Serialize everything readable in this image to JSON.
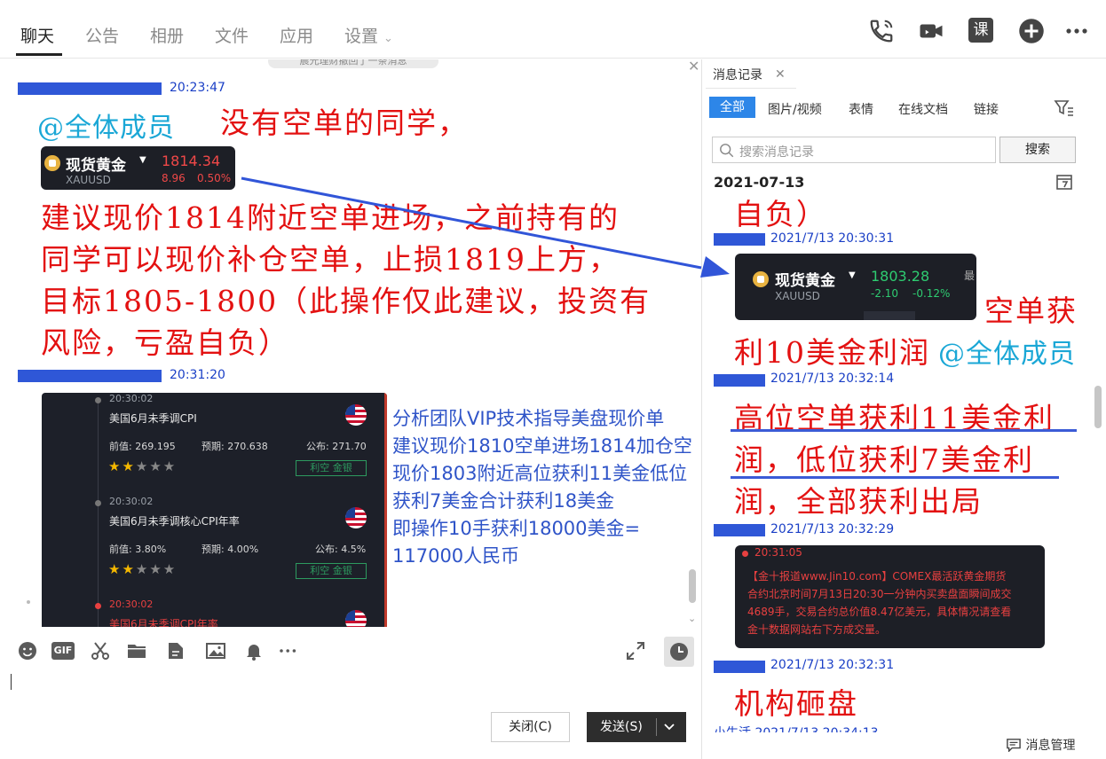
{
  "tabs": {
    "chat": "聊天",
    "notice": "公告",
    "album": "相册",
    "files": "文件",
    "apps": "应用",
    "settings": "设置"
  },
  "header_icons": [
    "phone-icon",
    "video-call-icon",
    "lesson-icon",
    "add-circle-icon",
    "more-icon"
  ],
  "header_lesson_label": "课",
  "chat": {
    "notice_pill": "晨光理财撤回了一条消息",
    "messages": [
      {
        "time": "20:23:47",
        "mention": "@全体成员",
        "headline": "没有空单的同学，",
        "ticker": {
          "name": "现货黄金",
          "symbol": "XAUUSD",
          "price": "1814.34",
          "change": "8.96",
          "change_pct": "0.50%"
        },
        "body_lines": [
          "建议现价1814附近空单进场，之前持有的",
          "同学可以现价补仓空单，止损1819上方，",
          "目标1805-1800（此操作仅此建议，投资有",
          "风险，亏盈自负）"
        ]
      },
      {
        "time": "20:31:20",
        "calendar": [
          {
            "time": "20:30:02",
            "title": "美国6月未季调CPI",
            "prev": "前值: 269.195",
            "forecast": "预期: 270.638",
            "actual": "公布: 271.70",
            "stars": 2,
            "badge": "利空  金银"
          },
          {
            "time": "20:30:02",
            "title": "美国6月未季调核心CPI年率",
            "prev": "前值: 3.80%",
            "forecast": "预期: 4.00%",
            "actual": "公布: 4.5%",
            "stars": 2,
            "badge": "利空  金银"
          },
          {
            "time": "20:30:02",
            "title": "美国6月未季调CPI年率"
          }
        ],
        "analysis_lines": [
          "分析团队VIP技术指导美盘现价单",
          "建议现价1810空单进场1814加仓空",
          "现价1803附近高位获利11美金低位",
          "获利7美金合计获利18美金",
          "即操作10手获利18000美金=",
          "117000人民币"
        ]
      }
    ],
    "toolbar_gif": "GIF"
  },
  "input": {
    "close_label": "关闭(C)",
    "send_label": "发送(S)"
  },
  "history": {
    "title": "消息记录",
    "filters": [
      "全部",
      "图片/视频",
      "表情",
      "在线文档",
      "链接"
    ],
    "search_placeholder": "搜索消息记录",
    "search_button": "搜索",
    "date": "2021-07-13",
    "snippet_top": "自负）",
    "entries": [
      {
        "time": "2021/7/13 20:30:31",
        "ticker": {
          "name": "现货黄金",
          "symbol": "XAUUSD",
          "price": "1803.28",
          "change": "-2.10",
          "change_pct": "-0.12%",
          "edge": "最"
        },
        "lines": [
          "空单获",
          "利10美金利润"
        ],
        "mention": "@全体成员"
      },
      {
        "time": "2021/7/13 20:32:14",
        "lines": [
          "高位空单获利11美金利",
          "润，低位获利7美金利",
          "润，全部获利出局"
        ]
      },
      {
        "time": "2021/7/13 20:32:29",
        "news": {
          "time": "20:31:05",
          "lines": [
            "【金十报道www.Jin10.com】COMEX最活跃黄金期货",
            "合约北京时间7月13日20:30一分钟内买卖盘面瞬间成交",
            "4689手，交易合约总价值8.47亿美元，具体情况请查看",
            "金十数据网站右下方成交量。"
          ]
        }
      },
      {
        "time": "2021/7/13 20:32:31",
        "lines": [
          "机构砸盘"
        ]
      },
      {
        "time": "小生活 2021/7/13 20:34:13"
      }
    ],
    "footer": "消息管理"
  },
  "colors": {
    "accent_red": "#e31111",
    "time_blue": "#1a3fc6",
    "analysis_blue": "#2f54c8",
    "mention_cyan": "#1aa7d6",
    "filter_active": "#2d86e8",
    "gain_green": "#2ecc71",
    "loss_red": "#f04848"
  }
}
